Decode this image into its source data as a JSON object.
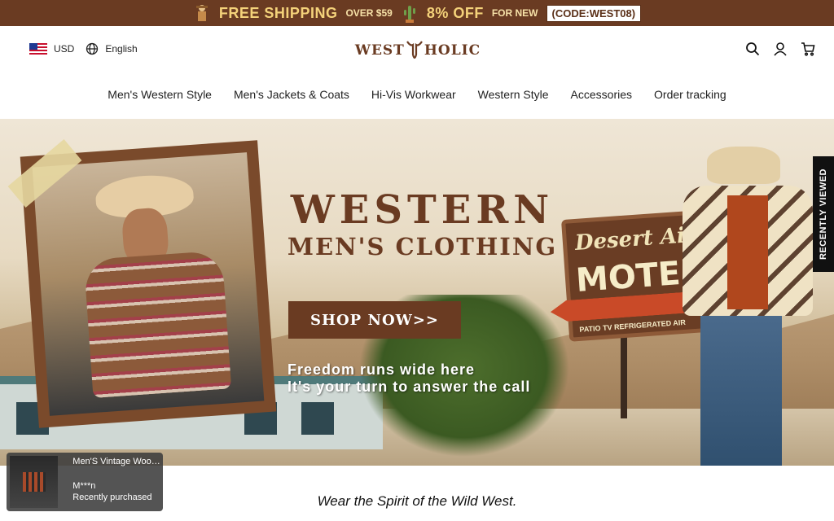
{
  "promo": {
    "free_shipping": "FREE SHIPPING",
    "over": "OVER $59",
    "discount": "8% OFF",
    "for_new": "FOR NEW",
    "code": "(CODE:WEST08)"
  },
  "header": {
    "currency": "USD",
    "language": "English",
    "logo_left": "WEST",
    "logo_right": "HOLIC"
  },
  "nav": {
    "items": [
      "Men's Western Style",
      "Men's Jackets & Coats",
      "Hi-Vis Workwear",
      "Western Style",
      "Accessories",
      "Order tracking"
    ]
  },
  "hero": {
    "headline_1": "WESTERN",
    "headline_2": "MEN'S CLOTHING",
    "button": "SHOP NOW>>",
    "tagline_1": "Freedom runs wide here",
    "tagline_2": "It's your turn to answer the call",
    "sign_script": "Desert Air",
    "sign_main": "MOTEL",
    "sign_small": "PATIO  TV  REFRIGERATED AIR"
  },
  "recently_viewed": "RECENTLY VIEWED",
  "toast": {
    "product": "Men'S Vintage Wool...",
    "user": "M***n",
    "status": "Recently purchased"
  },
  "section": {
    "title": "Wear the Spirit of the Wild West."
  },
  "colors": {
    "brand": "#6a3b22",
    "promo_text": "#f4d27a"
  }
}
